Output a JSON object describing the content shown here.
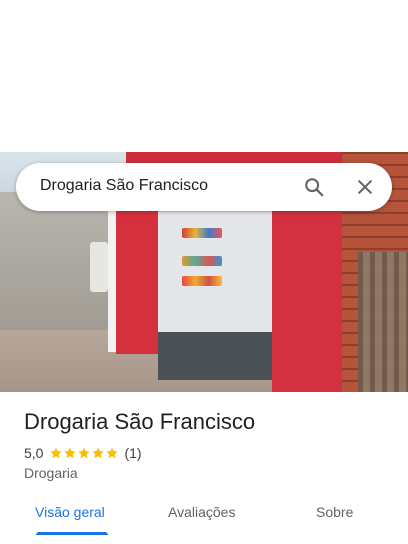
{
  "search": {
    "query": "Drogaria São Francisco"
  },
  "place": {
    "name": "Drogaria São Francisco",
    "rating": "5,0",
    "stars": 5,
    "review_count": "(1)",
    "category": "Drogaria"
  },
  "tabs": [
    {
      "label": "Visão geral",
      "active": true
    },
    {
      "label": "Avaliações",
      "active": false
    },
    {
      "label": "Sobre",
      "active": false
    }
  ],
  "colors": {
    "accent": "#1a73e8",
    "star": "#fbbc04",
    "storefront_red": "#d3313f"
  },
  "icons": {
    "search": "search-icon",
    "close": "close-icon",
    "star": "star-icon"
  }
}
